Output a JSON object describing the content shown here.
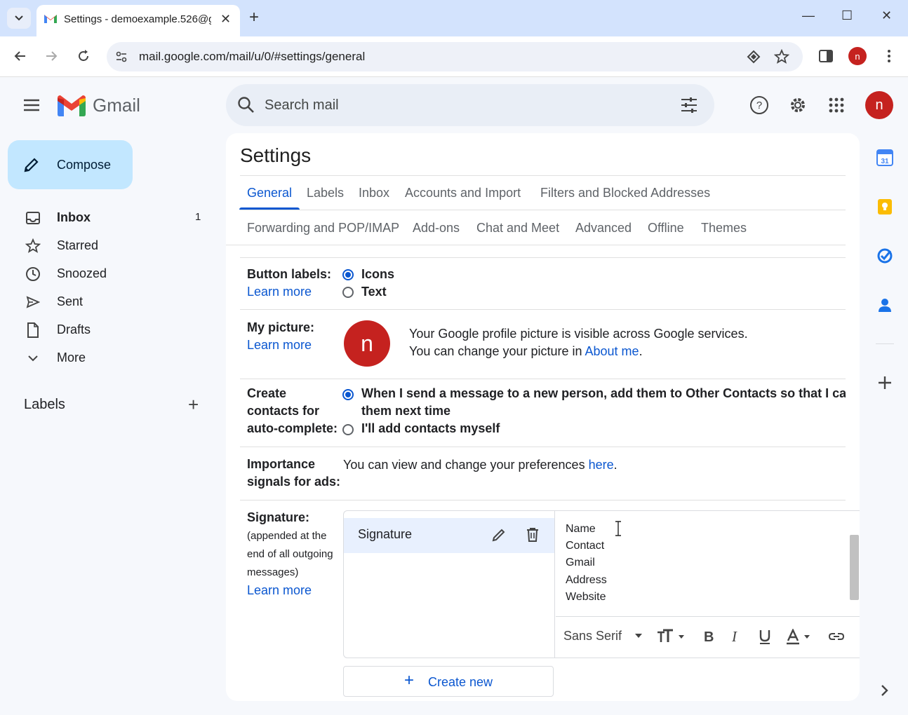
{
  "browser": {
    "tab_title": "Settings - demoexample.526@g",
    "url": "mail.google.com/mail/u/0/#settings/general",
    "profile_initial": "n"
  },
  "header": {
    "app_name": "Gmail",
    "search_placeholder": "Search mail",
    "avatar_initial": "n"
  },
  "sidebar": {
    "compose": "Compose",
    "items": [
      {
        "label": "Inbox",
        "count": "1"
      },
      {
        "label": "Starred"
      },
      {
        "label": "Snoozed"
      },
      {
        "label": "Sent"
      },
      {
        "label": "Drafts"
      },
      {
        "label": "More"
      }
    ],
    "labels_heading": "Labels"
  },
  "settings": {
    "title": "Settings",
    "tabs_row1": [
      "General",
      "Labels",
      "Inbox",
      "Accounts and Import",
      "Filters and Blocked Addresses"
    ],
    "tabs_row2": [
      "Forwarding and POP/IMAP",
      "Add-ons",
      "Chat and Meet",
      "Advanced",
      "Offline",
      "Themes"
    ],
    "learn_more": "Learn more",
    "button_labels": {
      "label": "Button labels:",
      "options": [
        "Icons",
        "Text"
      ]
    },
    "my_picture": {
      "label": "My picture:",
      "initial": "n",
      "line1": "Your Google profile picture is visible across Google services.",
      "line2_prefix": "You can change your picture in ",
      "line2_link": "About me",
      "line2_suffix": "."
    },
    "create_contacts": {
      "label_lines": [
        "Create",
        "contacts for",
        "auto-complete:"
      ],
      "option1_line1": "When I send a message to a new person, add them to Other Contacts so that I ca",
      "option1_line2": "them next time",
      "option2": "I'll add contacts myself"
    },
    "importance": {
      "label_lines": [
        "Importance",
        "signals for ads:"
      ],
      "text_prefix": "You can view and change your preferences ",
      "link": "here",
      "text_suffix": "."
    },
    "signature": {
      "label": "Signature:",
      "sub_lines": [
        "(appended at the",
        "end of all outgoing",
        "messages)"
      ],
      "item_name": "Signature",
      "content_lines": [
        "Name",
        "Contact",
        "Gmail",
        "Address",
        "Website"
      ],
      "font": "Sans Serif",
      "create_new": "Create new"
    }
  }
}
